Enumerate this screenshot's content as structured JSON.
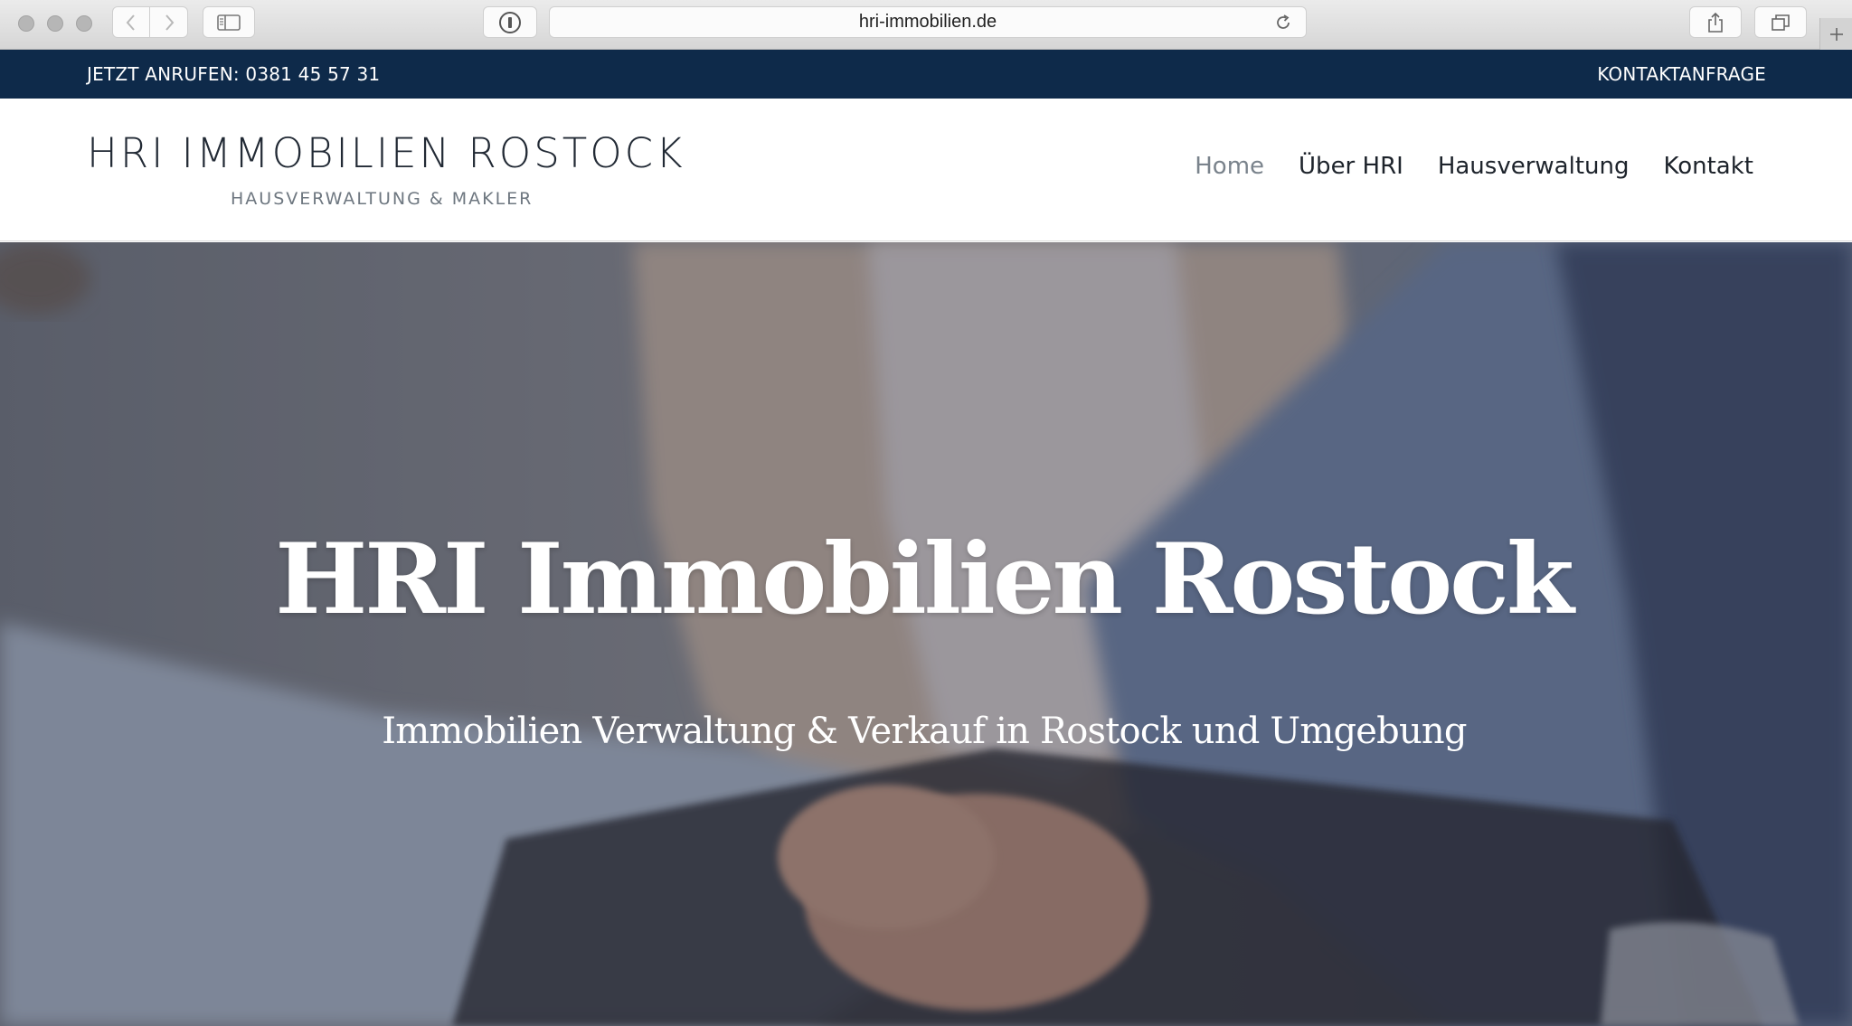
{
  "browser": {
    "url": "hri-immobilien.de"
  },
  "topbar": {
    "phone_text": "JETZT ANRUFEN: 0381 45 57 31",
    "contact_text": "KONTAKTANFRAGE"
  },
  "header": {
    "logo_title": "HRI IMMOBILIEN ROSTOCK",
    "logo_subtitle": "HAUSVERWALTUNG & MAKLER",
    "nav": [
      {
        "label": "Home",
        "active": true
      },
      {
        "label": "Über HRI",
        "active": false
      },
      {
        "label": "Hausverwaltung",
        "active": false
      },
      {
        "label": "Kontakt",
        "active": false
      }
    ]
  },
  "hero": {
    "title": "HRI Immobilien Rostock",
    "subtitle": "Immobilien Verwaltung & Verkauf in Rostock und Umgebung"
  },
  "colors": {
    "topbar_bg": "#0e2a4a",
    "nav_active": "#7a838c",
    "nav_text": "#1d232b"
  }
}
